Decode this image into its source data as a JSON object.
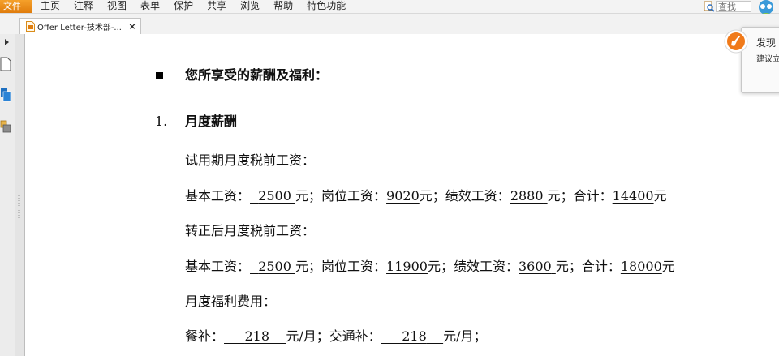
{
  "menubar": {
    "file_label": "文件",
    "items": [
      "主页",
      "注释",
      "视图",
      "表单",
      "保护",
      "共享",
      "浏览",
      "帮助",
      "特色功能"
    ],
    "search_placeholder": "查找"
  },
  "tab": {
    "title": "Offer Letter-技术部-...",
    "close": "×"
  },
  "popup": {
    "title": "发现",
    "subtitle": "建议立"
  },
  "document": {
    "section_heading": "您所享受的薪酬及福利：",
    "item_number": "1.",
    "item_title": "月度薪酬",
    "probation_title": "试用期月度税前工资：",
    "probation": {
      "base_label": "基本工资：",
      "base_value": "2500",
      "unit": "元",
      "sep": "；",
      "post_label": "岗位工资：",
      "post_value": "9020",
      "perf_label": "绩效工资：",
      "perf_value": "2880",
      "total_label": "合计：",
      "total_value": "14400"
    },
    "regular_title": "转正后月度税前工资：",
    "regular": {
      "base_label": "基本工资：",
      "base_value": "2500",
      "unit": "元",
      "sep": "；",
      "post_label": "岗位工资：",
      "post_value": "11900",
      "perf_label": "绩效工资：",
      "perf_value": "3600",
      "total_label": "合计：",
      "total_value": "18000"
    },
    "welfare_title": "月度福利费用：",
    "welfare": {
      "meal_label": "餐补：",
      "meal_value": "218",
      "unit": "元/月",
      "sep": "；",
      "transport_label": "交通补：",
      "transport_value": "218"
    }
  }
}
